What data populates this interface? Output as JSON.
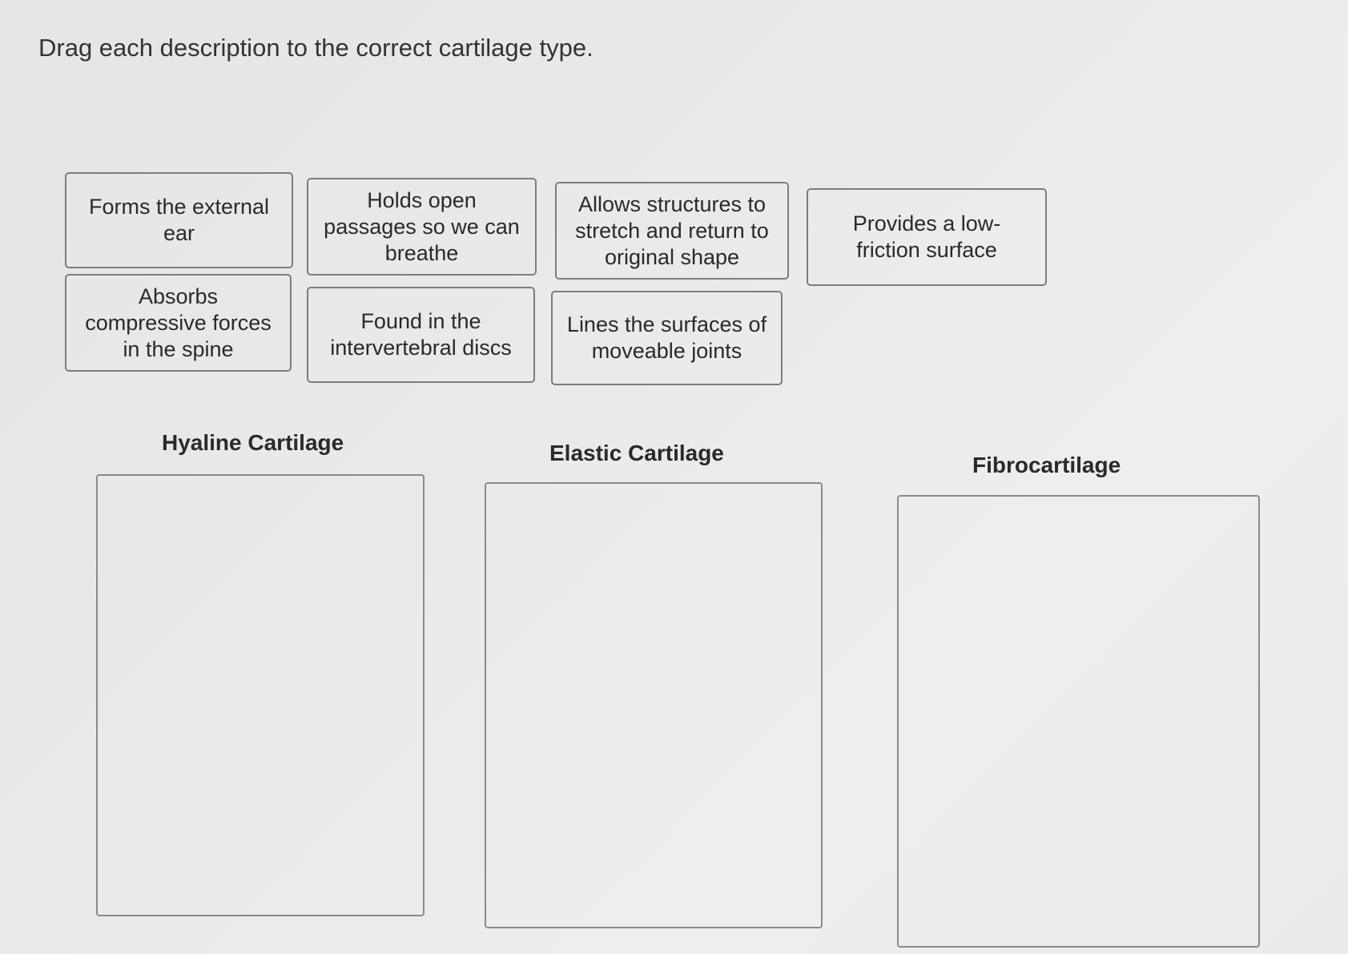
{
  "instruction": "Drag each description to the correct cartilage type.",
  "cards": [
    {
      "label": "Forms the external ear"
    },
    {
      "label": "Holds open passages so we can breathe"
    },
    {
      "label": "Allows structures to stretch and return to original shape"
    },
    {
      "label": "Provides a low-friction surface"
    },
    {
      "label": "Absorbs compressive forces in the spine"
    },
    {
      "label": "Found in the intervertebral discs"
    },
    {
      "label": "Lines the surfaces of moveable joints"
    }
  ],
  "zones": [
    {
      "label": "Hyaline Cartilage"
    },
    {
      "label": "Elastic Cartilage"
    },
    {
      "label": "Fibrocartilage"
    }
  ]
}
